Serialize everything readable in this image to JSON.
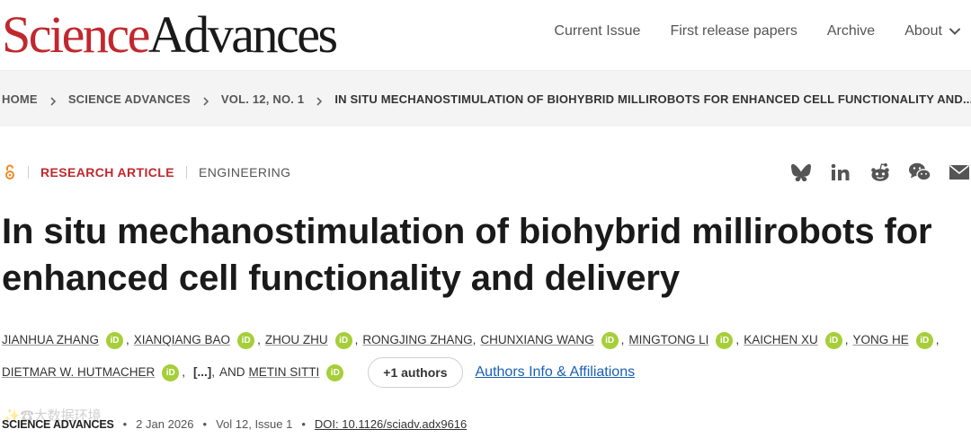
{
  "header": {
    "logo_science": "Science",
    "logo_advances": "Advances",
    "nav": {
      "current_issue": "Current Issue",
      "first_release": "First release papers",
      "archive": "Archive",
      "about": "About"
    }
  },
  "breadcrumb": {
    "items": [
      "HOME",
      "SCIENCE ADVANCES",
      "VOL. 12, NO. 1"
    ],
    "current": "IN SITU MECHANOSTIMULATION OF BIOHYBRID MILLIROBOTS FOR ENHANCED CELL FUNCTIONALITY AND..."
  },
  "article": {
    "type": "RESEARCH ARTICLE",
    "subject": "ENGINEERING",
    "title": "In situ mechanostimulation of biohybrid millirobots for enhanced cell functionality and delivery",
    "authors_row1": [
      "JIANHUA ZHANG",
      "XIANQIANG BAO",
      "ZHOU ZHU",
      "RONGJING ZHANG",
      "CHUNXIANG WANG",
      "MINGTONG LI",
      "KAICHEN XU",
      "YONG HE"
    ],
    "authors_row2": [
      "DIETMAR W. HUTMACHER",
      "METIN SITTI"
    ],
    "and_text": "AND",
    "ellipsis": "[...]",
    "plus_authors": "+1 authors",
    "affiliations_link": "Authors Info & Affiliations",
    "orcid_label": "iD"
  },
  "publication": {
    "journal": "SCIENCE ADVANCES",
    "date": "2 Jan 2026",
    "volume": "Vol 12, Issue 1",
    "doi": "DOI: 10.1126/sciadv.adx9616"
  },
  "watermark": "✨☎大数据环境",
  "colors": {
    "brand_red": "#c0282d",
    "orcid_green": "#a6ce39",
    "link_blue": "#1a5fb4"
  },
  "share_icons": [
    "bluesky-icon",
    "linkedin-icon",
    "reddit-icon",
    "wechat-icon",
    "email-icon"
  ]
}
